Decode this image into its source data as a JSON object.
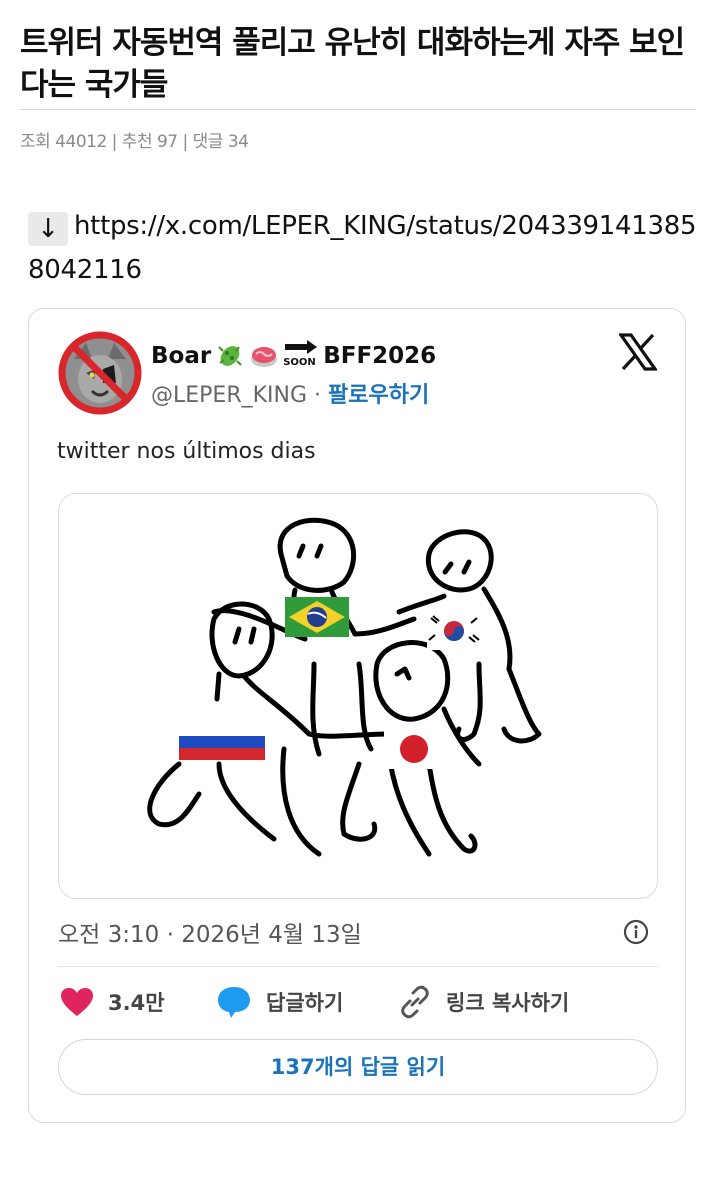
{
  "post": {
    "title": "트위터 자동번역 풀리고 유난히 대화하는게 자주 보인다는 국가들",
    "meta": "조회 44012 | 추천 97 | 댓글 34"
  },
  "source": {
    "arrow": "↓",
    "url": "https://x.com/LEPER_KING/status/2043391413858042116"
  },
  "tweet": {
    "author_name": "Boar",
    "author_name_suffix": "BFF2026",
    "soon_label": "SOON",
    "handle": "@LEPER_KING",
    "separator": " · ",
    "follow_label": "팔로우하기",
    "text": "twitter nos últimos dias",
    "timestamp": "오전 3:10 · 2026년 4월 13일",
    "likes_count": "3.4만",
    "reply_label": "답글하기",
    "copy_link_label": "링크 복사하기",
    "read_replies_label": "137개의 답글 읽기"
  },
  "colors": {
    "accent": "#1a73b8",
    "like": "#e0245e",
    "reply": "#1d9bf0"
  },
  "icons": [
    "down-arrow-icon",
    "microbe-icon",
    "meat-icon",
    "soon-arrow-icon",
    "x-logo-icon",
    "info-icon",
    "heart-icon",
    "reply-bubble-icon",
    "link-icon"
  ]
}
